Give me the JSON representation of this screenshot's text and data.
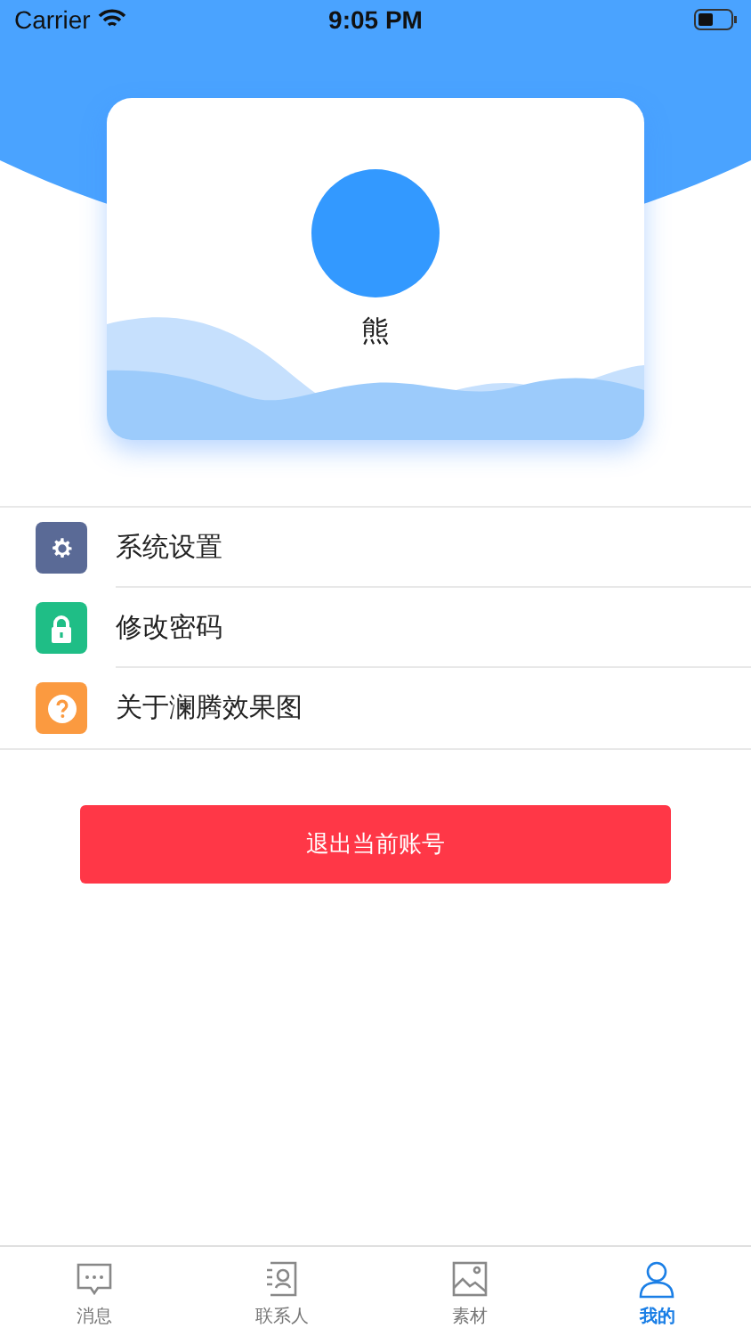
{
  "status_bar": {
    "carrier": "Carrier",
    "time": "9:05 PM"
  },
  "profile": {
    "name": "熊"
  },
  "menu": [
    {
      "kind": "settings",
      "label": "系统设置",
      "color": "#5a6a96"
    },
    {
      "kind": "lock",
      "label": "修改密码",
      "color": "#1fbe86"
    },
    {
      "kind": "help",
      "label": "关于澜腾效果图",
      "color": "#fb9a40"
    }
  ],
  "logout_button": "退出当前账号",
  "tabs": [
    {
      "kind": "chat",
      "label": "消息",
      "selected": false
    },
    {
      "kind": "contacts",
      "label": "联系人",
      "selected": false
    },
    {
      "kind": "image",
      "label": "素材",
      "selected": false
    },
    {
      "kind": "person",
      "label": "我的",
      "selected": true
    }
  ]
}
